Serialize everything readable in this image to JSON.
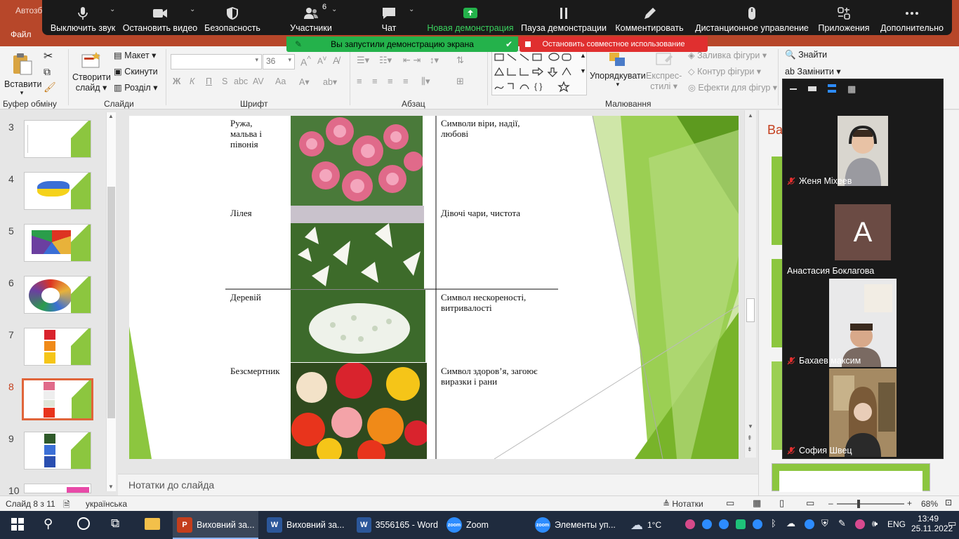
{
  "ppt": {
    "autosave": "Автозб",
    "file_tab": "Файл"
  },
  "zoom_toolbar": {
    "mute": "Выключить звук",
    "stop_video": "Остановить видео",
    "security": "Безопасность",
    "participants": "Участники",
    "participants_count": "6",
    "chat": "Чат",
    "new_share": "Новая демонстрация",
    "pause_share": "Пауза демонстрации",
    "annotate": "Комментировать",
    "remote_control": "Дистанционное управление",
    "apps": "Приложения",
    "more": "Дополнительно",
    "sharing_notice": "Вы запустили демонстрацию экрана",
    "stop_share": "Остановить совместное использование",
    "share_color": "#24b24b",
    "stop_color": "#e02f2f"
  },
  "ribbon": {
    "clipboard": {
      "paste": "Вставити",
      "group": "Буфер обміну"
    },
    "slides": {
      "new_slide_1": "Створити",
      "new_slide_2": "слайд",
      "layout": "Макет",
      "reset": "Скинути",
      "section": "Розділ",
      "group": "Слайди"
    },
    "font": {
      "size": "36",
      "bold": "Ж",
      "italic": "К",
      "underline": "П",
      "strike": "S",
      "shadow": "abc",
      "spacing": "AV",
      "case": "Aa",
      "group": "Шрифт"
    },
    "paragraph": {
      "group": "Абзац"
    },
    "drawing": {
      "arrange": "Упорядкувати",
      "styles_1": "Експрес-",
      "styles_2": "стилі",
      "fill": "Заливка фігури",
      "outline": "Контур фігури",
      "effects": "Ефекти для фігур",
      "group": "Малювання"
    },
    "editing": {
      "find": "Знайти",
      "replace": "Замінити"
    }
  },
  "thumbnails": [
    {
      "num": "3"
    },
    {
      "num": "4"
    },
    {
      "num": "5"
    },
    {
      "num": "6"
    },
    {
      "num": "7"
    },
    {
      "num": "8",
      "selected": true
    },
    {
      "num": "9"
    },
    {
      "num": "10"
    }
  ],
  "slide": {
    "rows": [
      {
        "name": "Ружа,\nмальва і\nпівонія",
        "meaning": "Символи віри, надії,\nлюбові",
        "image": "pink-hollyhock-flowers"
      },
      {
        "name": "Лілея",
        "meaning": "Дівочі чари, чистота",
        "image": "white-lily-flowers"
      },
      {
        "name": "Деревій",
        "meaning": "Символ нескореності,\nвитривалості",
        "image": "white-yarrow-flowers"
      },
      {
        "name": "Безсмертник",
        "meaning": "Символ здоров’я, загоює\nвиразки і рани",
        "image": "strawflower-flowers"
      }
    ],
    "accent": "#8cc63f"
  },
  "notes_placeholder": "Нотатки до слайда",
  "right_panel": {
    "title": "Ва"
  },
  "gallery": {
    "participants": [
      {
        "name": "Женя Міхеев",
        "video": true,
        "muted": true
      },
      {
        "name": "Анастасия Боклагова",
        "video": false,
        "initial": "A",
        "muted": false
      },
      {
        "name": "Бахаев максим",
        "video": true,
        "muted": true
      },
      {
        "name": "София Швец",
        "video": true,
        "muted": true
      }
    ]
  },
  "status_bar": {
    "slide_of": "Слайд 8 з 11",
    "language": "українська",
    "notes": "Нотатки",
    "zoom": "68%"
  },
  "taskbar": {
    "apps": [
      {
        "label": "Виховний за...",
        "icon": "P",
        "color": "#c43e1c",
        "active": true
      },
      {
        "label": "Виховний за...",
        "icon": "W",
        "color": "#2b579a"
      },
      {
        "label": "3556165 - Word",
        "icon": "W",
        "color": "#2b579a"
      },
      {
        "label": "Zoom",
        "icon": "zoom",
        "color": "#2d8cff"
      },
      {
        "label": "Элементы уп...",
        "icon": "zoom",
        "color": "#2d8cff"
      }
    ],
    "weather": "1°C",
    "lang": "ENG",
    "time": "13:49",
    "date": "25.11.2022"
  }
}
